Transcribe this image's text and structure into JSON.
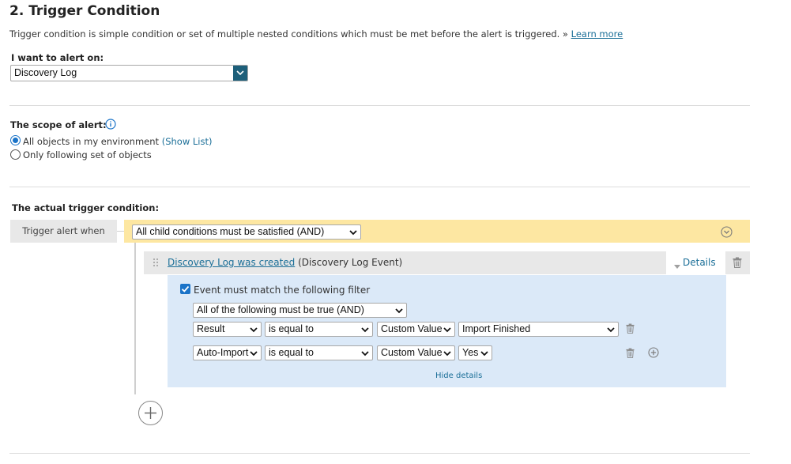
{
  "header": {
    "title": "2. Trigger Condition",
    "description": "Trigger condition is simple condition or set of multiple nested conditions which must be met before the alert is triggered. » ",
    "learn_more": "Learn more"
  },
  "alert_on": {
    "label": "I want to alert on:",
    "value": "Discovery Log"
  },
  "scope": {
    "label": "The scope of alert:",
    "option_all": "All objects in my environment",
    "show_list": "(Show List)",
    "option_following": "Only following set of objects",
    "selected": "all"
  },
  "trigger": {
    "section_label": "The actual trigger condition:",
    "when_label": "Trigger alert when",
    "group_condition": "All child conditions must be satisfied (AND)",
    "condition": {
      "link_text": "Discovery Log was created",
      "type_text": "(Discovery Log Event)",
      "details_label": "Details"
    },
    "filter": {
      "checkbox_label": "Event must match the following filter",
      "checked": true,
      "logic": "All of the following must be true (AND)",
      "rows": [
        {
          "field": "Result",
          "operator": "is equal to",
          "value_type": "Custom Value",
          "value": "Import Finished"
        },
        {
          "field": "Auto-Import",
          "operator": "is equal to",
          "value_type": "Custom Value",
          "value": "Yes"
        }
      ],
      "hide_details": "Hide details"
    }
  },
  "colors": {
    "accent": "#1a73c8",
    "link": "#1b6f98",
    "group_bar": "#fde7a2",
    "filter_bg": "#dbe9f8",
    "dropdown_button": "#1d5f7a"
  }
}
